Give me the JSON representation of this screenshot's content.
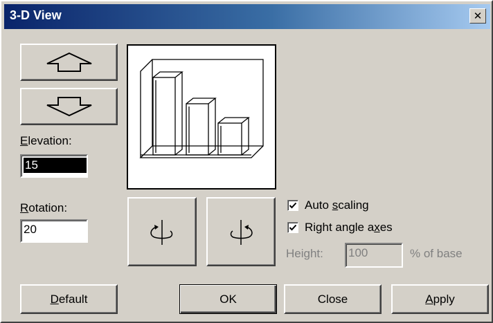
{
  "window": {
    "title": "3-D View",
    "close_glyph": "✕"
  },
  "elevation": {
    "label_prefix": "",
    "label_mnemonic": "E",
    "label_rest": "levation:",
    "value": "15"
  },
  "rotation": {
    "label_mnemonic": "R",
    "label_rest": "otation:",
    "value": "20"
  },
  "options": {
    "auto_scaling": {
      "label_a": "Auto ",
      "label_mnemonic": "s",
      "label_b": "caling",
      "checked": true
    },
    "right_angle": {
      "label_a": "Right angle a",
      "label_mnemonic": "x",
      "label_b": "es",
      "checked": true
    },
    "height": {
      "label": "Height:",
      "value": "100",
      "suffix": "% of base"
    }
  },
  "buttons": {
    "default_mnemonic": "D",
    "default_rest": "efault",
    "ok": "OK",
    "close": "Close",
    "apply_mnemonic": "A",
    "apply_rest": "pply"
  },
  "icons": {
    "up": "up-arrow-icon",
    "down": "down-arrow-icon",
    "rotate_left": "rotate-left-icon",
    "rotate_right": "rotate-right-icon"
  }
}
